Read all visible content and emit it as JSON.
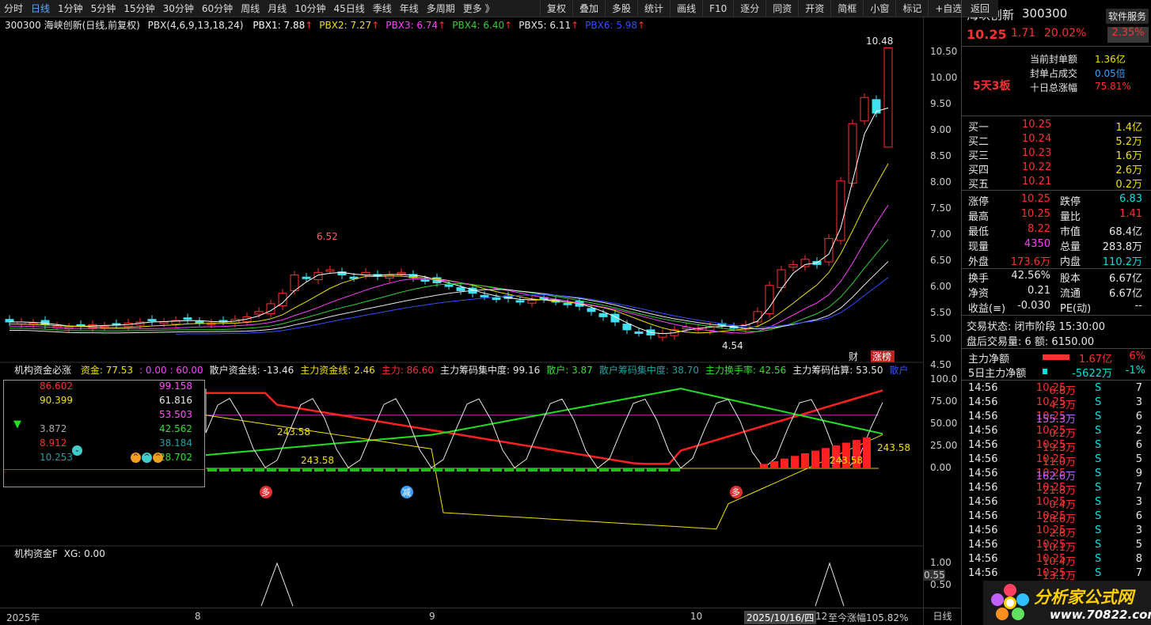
{
  "toolbar": {
    "periods": [
      "分时",
      "日线",
      "1分钟",
      "5分钟",
      "15分钟",
      "30分钟",
      "60分钟",
      "周线",
      "月线",
      "10分钟",
      "45日线",
      "季线",
      "年线",
      "多周期",
      "更多 》"
    ],
    "tools": [
      "复权",
      "叠加",
      "多股",
      "统计",
      "画线",
      "F10",
      "逐分",
      "同资",
      "开资",
      "简框",
      "小窗",
      "标记",
      "+自选"
    ],
    "back": "返回"
  },
  "chart_header": {
    "title": "300300 海峡创新(日线,前复权)",
    "indicator": "PBX(4,6,9,13,18,24)",
    "pbx": [
      {
        "label": "PBX1: 7.88",
        "color": "#ffffff"
      },
      {
        "label": "PBX2: 7.27",
        "color": "#f0e000"
      },
      {
        "label": "PBX3: 6.74",
        "color": "#ff40ff"
      },
      {
        "label": "PBX4: 6.40",
        "color": "#30d030"
      },
      {
        "label": "PBX5: 6.11",
        "color": "#e8e8e8"
      },
      {
        "label": "PBX6: 5.98",
        "color": "#3050ff"
      }
    ]
  },
  "price_axis": [
    "10.50",
    "10.00",
    "9.50",
    "9.00",
    "8.50",
    "8.00",
    "7.50",
    "7.00",
    "6.50",
    "6.00",
    "5.50",
    "5.00",
    "4.50"
  ],
  "price_annotations": {
    "high": "10.48",
    "peak_mid": "6.52",
    "low": "4.54",
    "cai": "财",
    "zt": "涨榜"
  },
  "sub_header": {
    "name": "机构资金必涨",
    "items": [
      {
        "label": "资金: 77.53",
        "color": "#f0e000"
      },
      {
        "label": ": 0.00 : 60.00",
        "color": "#ff40ff"
      },
      {
        "label": "散户资金线: -13.46",
        "color": "#e8e8e8"
      },
      {
        "label": "主力资金线: 2.46",
        "color": "#f0e000"
      },
      {
        "label": "主力: 86.60",
        "color": "#ff3030"
      },
      {
        "label": "主力筹码集中度: 99.16",
        "color": "#e8e8e8"
      },
      {
        "label": "散户: 3.87",
        "color": "#30e030"
      },
      {
        "label": "散户筹码集中度: 38.70",
        "color": "#20a0a0"
      },
      {
        "label": "主力换手率: 42.56",
        "color": "#30e030"
      },
      {
        "label": "主力筹码估算: 53.50",
        "color": "#e8e8e8"
      },
      {
        "label": "散户",
        "color": "#3050ff"
      }
    ],
    "axis": [
      "100.0",
      "75.00",
      "50.00",
      "25.00",
      "0.00"
    ],
    "tags": [
      "243.58",
      "243.58",
      "243.58",
      "243.58"
    ],
    "badges": {
      "duo": "多",
      "jian": "减"
    }
  },
  "info_box": {
    "left": [
      {
        "v": "86.602",
        "c": "#ff3030"
      },
      {
        "v": "90.399",
        "c": "#f0e000"
      },
      {
        "v": "",
        "c": "#000"
      },
      {
        "v": "3.872",
        "c": "#aaaaaa"
      },
      {
        "v": "8.912",
        "c": "#ff3030"
      },
      {
        "v": "10.253",
        "c": "#20a0a0"
      }
    ],
    "right": [
      {
        "v": "99.158",
        "c": "#ff50ff"
      },
      {
        "v": "61.816",
        "c": "#e8e8e8"
      },
      {
        "v": "53.503",
        "c": "#ff50ff"
      },
      {
        "v": "42.562",
        "c": "#30e030"
      },
      {
        "v": "38.184",
        "c": "#20a0a0"
      },
      {
        "v": "28.702",
        "c": "#30e030"
      }
    ]
  },
  "sub2_header": {
    "name": "机构资金F",
    "xg": "XG: 0.00",
    "axis": [
      "1.00",
      "0.55",
      "0.50"
    ]
  },
  "time_axis": {
    "labels": [
      "2025年",
      "8",
      "9",
      "10"
    ],
    "cursor": "2025/10/16/四",
    "day": "12",
    "gain": "至今涨幅105.82%",
    "period": "日线"
  },
  "stock": {
    "name": "海峡创新",
    "code": "300300",
    "service": "软件服务",
    "service_pct": "2.35%",
    "price": "10.25",
    "change": "1.71",
    "pct": "20.02%",
    "lianban": "5天3板",
    "seal": [
      {
        "k": "当前封单额",
        "v": "1.36亿",
        "c": "#f0e000"
      },
      {
        "k": "封单占成交",
        "v": "0.05倍",
        "c": "#3a9eff"
      },
      {
        "k": "十日总涨幅",
        "v": "75.81%",
        "c": "#ff3030"
      }
    ]
  },
  "orderbook": [
    {
      "k": "买一",
      "p": "10.25",
      "v": "1.4亿"
    },
    {
      "k": "买二",
      "p": "10.24",
      "v": "5.2万"
    },
    {
      "k": "买三",
      "p": "10.23",
      "v": "1.6万"
    },
    {
      "k": "买四",
      "p": "10.22",
      "v": "2.6万"
    },
    {
      "k": "买五",
      "p": "10.21",
      "v": "0.2万"
    }
  ],
  "quote": [
    {
      "k1": "涨停",
      "v1": "10.25",
      "c1": "#ff3030",
      "k2": "跌停",
      "v2": "6.83",
      "c2": "#00e0e0"
    },
    {
      "k1": "最高",
      "v1": "10.25",
      "c1": "#ff3030",
      "k2": "量比",
      "v2": "1.41",
      "c2": "#ff3030"
    },
    {
      "k1": "最低",
      "v1": "8.22",
      "c1": "#ff3030",
      "k2": "市值",
      "v2": "68.4亿",
      "c2": "#e8e8e8"
    },
    {
      "k1": "现量",
      "v1": "4350",
      "c1": "#ff40ff",
      "k2": "总量",
      "v2": "283.8万",
      "c2": "#e8e8e8"
    },
    {
      "k1": "外盘",
      "v1": "173.6万",
      "c1": "#ff3030",
      "k2": "内盘",
      "v2": "110.2万",
      "c2": "#00e0e0"
    }
  ],
  "stats": [
    {
      "k1": "换手",
      "v1": "42.56%",
      "k2": "股本",
      "v2": "6.67亿"
    },
    {
      "k1": "净资",
      "v1": "0.21",
      "k2": "流通",
      "v2": "6.67亿"
    },
    {
      "k1": "收益(≡)",
      "v1": "-0.030",
      "k2": "PE(动)",
      "v2": "--"
    }
  ],
  "trade_status": "交易状态: 闭市阶段 15:30:00",
  "after_hours": "盘后交易量: 6  额: 6150.00",
  "capital": [
    {
      "k": "主力净额",
      "v": "1.67亿",
      "p": "6%",
      "c": "#ff3030"
    },
    {
      "k": "5日主力净额",
      "v": "-5622万",
      "p": "-1%",
      "c": "#00e0e0"
    }
  ],
  "ticks": [
    {
      "t": "14:56",
      "p": "10.25",
      "v": "6.8万",
      "s": "S",
      "n": "7"
    },
    {
      "t": "14:56",
      "p": "10.25",
      "v": "4.3万",
      "s": "S",
      "n": "3"
    },
    {
      "t": "14:56",
      "p": "10.25",
      "v": "155.3万",
      "s": "S",
      "n": "6"
    },
    {
      "t": "14:56",
      "p": "10.25",
      "v": "0.2万",
      "s": "S",
      "n": "2"
    },
    {
      "t": "14:56",
      "p": "10.25",
      "v": "19.3万",
      "s": "S",
      "n": "6"
    },
    {
      "t": "14:56",
      "p": "10.25",
      "v": "11.0万",
      "s": "S",
      "n": "5"
    },
    {
      "t": "14:56",
      "p": "10.25",
      "v": "162.6万",
      "s": "S",
      "n": "9"
    },
    {
      "t": "14:56",
      "p": "10.25",
      "v": "21.8万",
      "s": "S",
      "n": "7"
    },
    {
      "t": "14:56",
      "p": "10.25",
      "v": "0.4万",
      "s": "S",
      "n": "3"
    },
    {
      "t": "14:56",
      "p": "10.25",
      "v": "28.6万",
      "s": "S",
      "n": "6"
    },
    {
      "t": "14:56",
      "p": "10.25",
      "v": "2.8万",
      "s": "S",
      "n": "3"
    },
    {
      "t": "14:56",
      "p": "10.25",
      "v": "10.1万",
      "s": "S",
      "n": "5"
    },
    {
      "t": "14:56",
      "p": "10.25",
      "v": "10.4万",
      "s": "S",
      "n": "8"
    },
    {
      "t": "14:56",
      "p": "10.25",
      "v": "13.1万",
      "s": "S",
      "n": "7"
    }
  ],
  "logo": {
    "text": "分析家公式网",
    "url": "www.70822.com"
  }
}
